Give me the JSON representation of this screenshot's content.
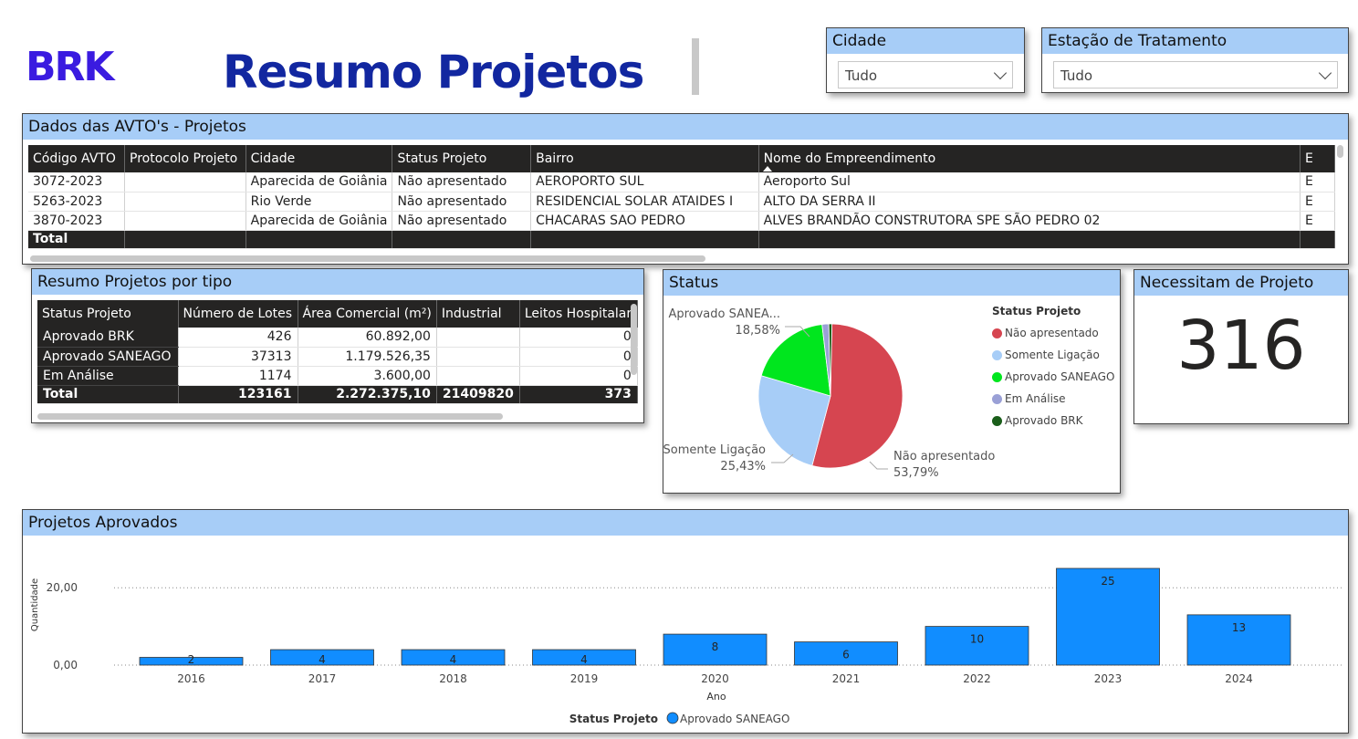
{
  "header": {
    "logo": "BRK",
    "title": "Resumo Projetos"
  },
  "slicers": {
    "cidade": {
      "title": "Cidade",
      "value": "Tudo"
    },
    "estacao": {
      "title": "Estação de Tratamento",
      "value": "Tudo"
    }
  },
  "avto_table": {
    "title": "Dados das AVTO's - Projetos",
    "columns": [
      "Código AVTO",
      "Protocolo Projeto",
      "Cidade",
      "Status Projeto",
      "Bairro",
      "Nome do Empreendimento",
      "E"
    ],
    "rows": [
      [
        "3072-2023",
        "",
        "Aparecida de Goiânia",
        "Não apresentado",
        "AEROPORTO SUL",
        "Aeroporto Sul",
        "E"
      ],
      [
        "5263-2023",
        "",
        "Rio Verde",
        "Não apresentado",
        "RESIDENCIAL SOLAR ATAIDES I",
        "ALTO DA SERRA II",
        "E"
      ],
      [
        "3870-2023",
        "",
        "Aparecida de Goiânia",
        "Não apresentado",
        "CHACARAS SAO PEDRO",
        "ALVES BRANDÃO CONSTRUTORA SPE SÃO PEDRO 02",
        "E"
      ]
    ],
    "total_label": "Total"
  },
  "resumo_table": {
    "title": "Resumo Projetos por tipo",
    "columns": [
      "Status Projeto",
      "Número de Lotes",
      "Área Comercial (m²)",
      "Industrial",
      "Leitos Hospitalar"
    ],
    "rows": [
      [
        "Aprovado BRK",
        "426",
        "60.892,00",
        "",
        "0"
      ],
      [
        "Aprovado SANEAGO",
        "37313",
        "1.179.526,35",
        "",
        "0"
      ],
      [
        "Em Análise",
        "1174",
        "3.600,00",
        "",
        "0"
      ]
    ],
    "total": [
      "Total",
      "123161",
      "2.272.375,10",
      "21409820",
      "373"
    ]
  },
  "status_chart": {
    "title": "Status",
    "legend_title": "Status Projeto",
    "colors": {
      "nao_apresentado": "#d64550",
      "somente_ligacao": "#a7cdf7",
      "aprovado_saneago": "#00e61e",
      "em_analise": "#9aa0d6",
      "aprovado_brk": "#1a5e1a"
    }
  },
  "card": {
    "title": "Necessitam de Projeto",
    "value": "316"
  },
  "approved_chart": {
    "title": "Projetos Aprovados",
    "legend_title": "Status Projeto",
    "legend_item": "Aprovado SANEAGO",
    "bar_color": "#118dff"
  },
  "chart_data": [
    {
      "type": "pie",
      "title": "Status",
      "legend_title": "Status Projeto",
      "slices": [
        {
          "name": "Não apresentado",
          "value": 53.79,
          "label": "53,79%"
        },
        {
          "name": "Somente Ligação",
          "value": 25.43,
          "label": "25,43%"
        },
        {
          "name": "Aprovado SANEAGO",
          "value": 18.58,
          "label": "18,58%"
        },
        {
          "name": "Em Análise",
          "value": 1.5
        },
        {
          "name": "Aprovado BRK",
          "value": 0.7
        }
      ],
      "labels_shown": [
        {
          "name": "Aprovado SANEA...",
          "pct": "18,58%"
        },
        {
          "name": "Somente Ligação",
          "pct": "25,43%"
        },
        {
          "name": "Não apresentado",
          "pct": "53,79%"
        }
      ]
    },
    {
      "type": "bar",
      "title": "Projetos Aprovados",
      "xlabel": "Ano",
      "ylabel": "Quantidade",
      "categories": [
        "2016",
        "2017",
        "2018",
        "2019",
        "2020",
        "2021",
        "2022",
        "2023",
        "2024"
      ],
      "series": [
        {
          "name": "Aprovado SANEAGO",
          "values": [
            2,
            4,
            4,
            4,
            8,
            6,
            10,
            25,
            13
          ]
        }
      ],
      "yticks": [
        "0,00",
        "20,00"
      ],
      "ylim": [
        0,
        25
      ],
      "grid": true,
      "legend": "bottom"
    }
  ]
}
